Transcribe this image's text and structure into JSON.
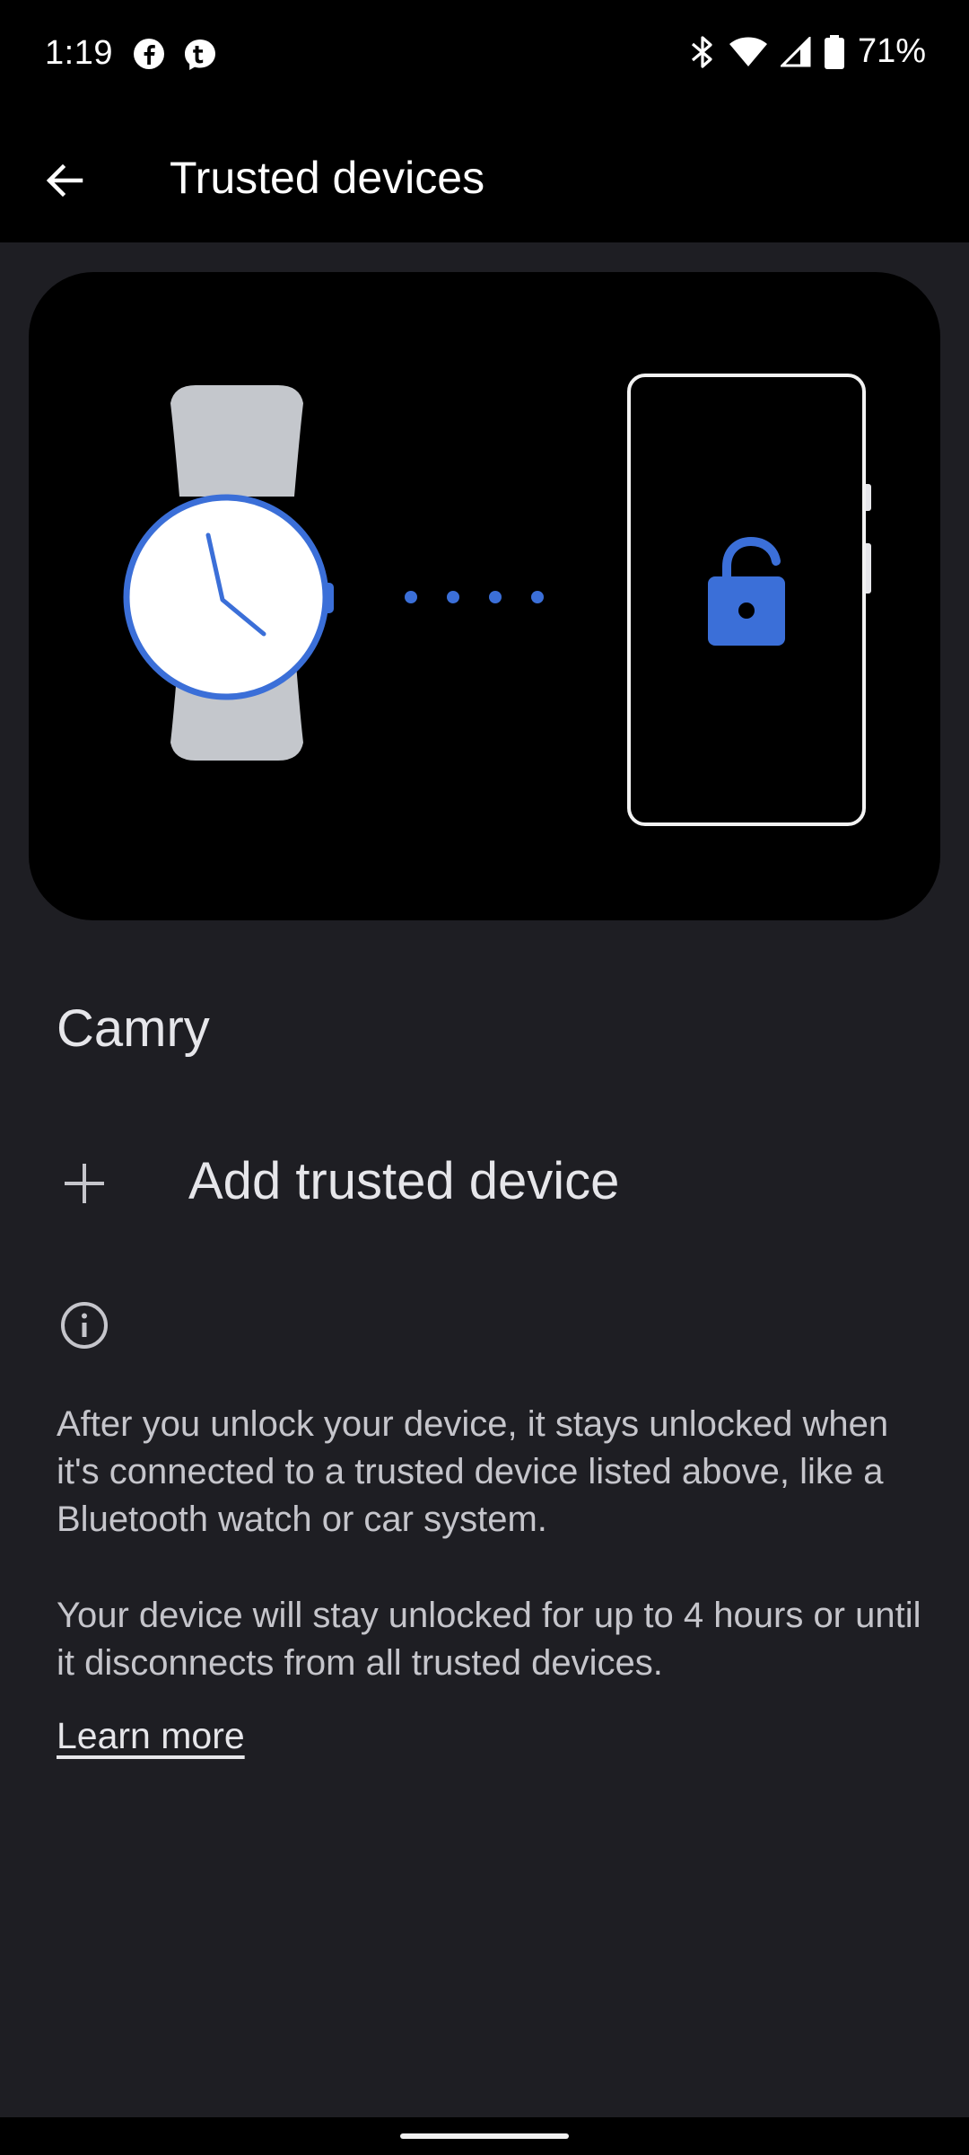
{
  "status_bar": {
    "time": "1:19",
    "battery_percent": "71%",
    "left_icons": [
      "facebook-icon",
      "messenger-icon"
    ],
    "right_icons": [
      "bluetooth-icon",
      "wifi-icon",
      "cell-signal-icon",
      "battery-icon"
    ]
  },
  "app_bar": {
    "title": "Trusted devices",
    "back_icon": "arrow-back-icon"
  },
  "illustration": {
    "left_device": "watch-icon",
    "right_device": "phone-icon",
    "lock_state": "unlocked",
    "accent_color": "#3b6fd8",
    "watch_band_color": "#c4c7cc"
  },
  "devices": [
    {
      "name": "Camry"
    }
  ],
  "add_device": {
    "label": "Add trusted device",
    "icon": "plus-icon"
  },
  "info": {
    "icon": "info-icon",
    "paragraph1": "After you unlock your device, it stays unlocked when it's connected to a trusted device listed above, like a Bluetooth watch or car system.",
    "paragraph2": "Your device will stay unlocked for up to 4 hours or until it disconnects from all trusted devices.",
    "learn_more": "Learn more"
  }
}
